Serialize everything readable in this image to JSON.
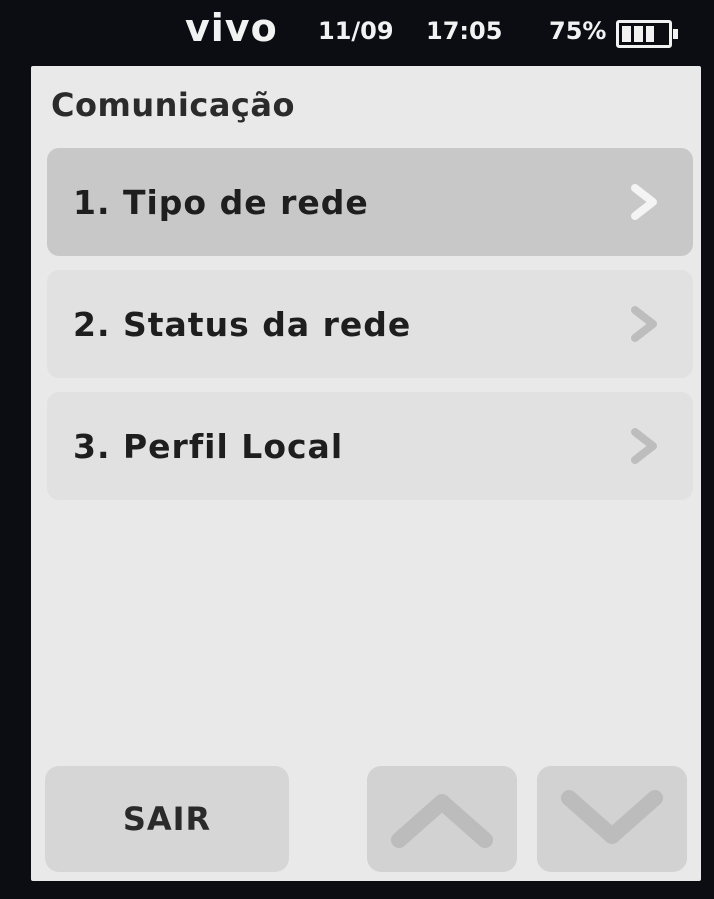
{
  "status_bar": {
    "carrier": "vivo",
    "date": "11/09",
    "time": "17:05",
    "battery_percent": "75%",
    "battery_level": 0.75
  },
  "screen": {
    "title": "Comunicação"
  },
  "menu": {
    "items": [
      {
        "label": "1. Tipo de rede",
        "selected": true,
        "icon": "chevron-right-icon"
      },
      {
        "label": "2. Status da rede",
        "selected": false,
        "icon": "chevron-right-icon"
      },
      {
        "label": "3. Perfil Local",
        "selected": false,
        "icon": "chevron-right-icon"
      }
    ]
  },
  "buttons": {
    "exit_label": "SAIR",
    "up_icon": "chevron-up-icon",
    "down_icon": "chevron-down-icon"
  },
  "colors": {
    "screen_background": "#e9e9e9",
    "selected_item": "#c8c8c8",
    "item_background": "#e1e1e1",
    "text": "#1e1e1e"
  }
}
